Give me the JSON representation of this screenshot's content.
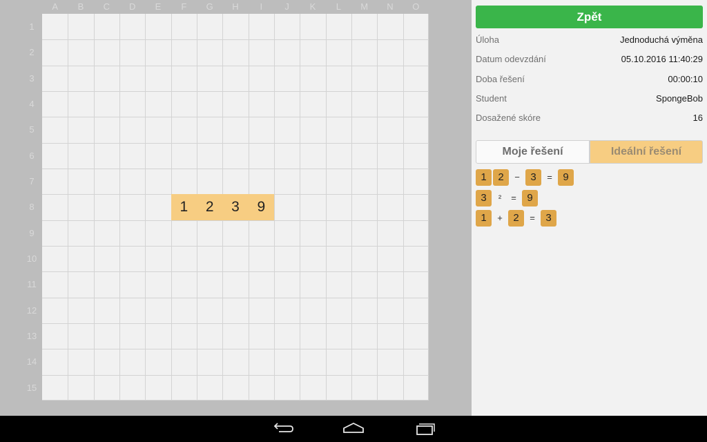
{
  "board": {
    "columns": [
      "A",
      "B",
      "C",
      "D",
      "E",
      "F",
      "G",
      "H",
      "I",
      "J",
      "K",
      "L",
      "M",
      "N",
      "O"
    ],
    "rows": [
      "1",
      "2",
      "3",
      "4",
      "5",
      "6",
      "7",
      "8",
      "9",
      "10",
      "11",
      "12",
      "13",
      "14",
      "15"
    ],
    "tiles": [
      {
        "col": 5,
        "row": 7,
        "value": "1"
      },
      {
        "col": 6,
        "row": 7,
        "value": "2"
      },
      {
        "col": 7,
        "row": 7,
        "value": "3"
      },
      {
        "col": 8,
        "row": 7,
        "value": "9"
      }
    ],
    "colors": {
      "background": "#bdbdbd",
      "grid": "#f1f1f1",
      "tile": "#f7cd82"
    }
  },
  "panel": {
    "back_label": "Zpět",
    "info": [
      {
        "label": "Úloha",
        "value": "Jednoduchá výměna"
      },
      {
        "label": "Datum odevzdání",
        "value": "05.10.2016 11:40:29"
      },
      {
        "label": "Doba řešení",
        "value": "00:00:10"
      },
      {
        "label": "Student",
        "value": "SpongeBob"
      },
      {
        "label": "Dosažené skóre",
        "value": "16"
      }
    ],
    "tabs": {
      "mine": "Moje řešení",
      "ideal": "Ideální řešení",
      "active": "ideal"
    },
    "equations": [
      [
        {
          "t": "tile",
          "v": "1"
        },
        {
          "t": "tile",
          "v": "2"
        },
        {
          "t": "op",
          "v": "−"
        },
        {
          "t": "tile",
          "v": "3"
        },
        {
          "t": "op",
          "v": "="
        },
        {
          "t": "tile",
          "v": "9"
        }
      ],
      [
        {
          "t": "tile",
          "v": "3"
        },
        {
          "t": "op",
          "v": "²"
        },
        {
          "t": "op",
          "v": "="
        },
        {
          "t": "tile",
          "v": "9"
        }
      ],
      [
        {
          "t": "tile",
          "v": "1"
        },
        {
          "t": "op",
          "v": "+"
        },
        {
          "t": "tile",
          "v": "2"
        },
        {
          "t": "op",
          "v": "="
        },
        {
          "t": "tile",
          "v": "3"
        }
      ]
    ],
    "colors": {
      "back_button": "#3ab54a",
      "tab_active": "#f7cd82",
      "eq_tile": "#dfa649"
    }
  },
  "navbar": {
    "buttons": [
      "back-icon",
      "home-icon",
      "recent-apps-icon"
    ]
  }
}
